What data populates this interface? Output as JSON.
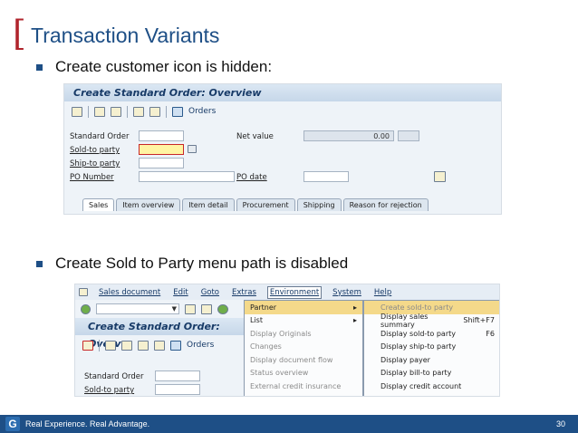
{
  "slide": {
    "title": "Transaction Variants",
    "bullet1": "Create customer icon is hidden:",
    "bullet2": "Create Sold to Party menu path is disabled"
  },
  "sap1": {
    "title": "Create Standard Order: Overview",
    "toolbar_orders": "Orders",
    "labels": {
      "standard_order": "Standard Order",
      "sold_to": "Sold-to party",
      "ship_to": "Ship-to party",
      "po_number": "PO Number",
      "net_value": "Net value",
      "po_date": "PO date"
    },
    "net_value_amount": "0.00",
    "tabs": [
      "Sales",
      "Item overview",
      "Item detail",
      "Procurement",
      "Shipping",
      "Reason for rejection"
    ]
  },
  "sap2": {
    "menubar": [
      "Sales document",
      "Edit",
      "Goto",
      "Extras",
      "Environment",
      "System",
      "Help"
    ],
    "title": "Create Standard Order: Overv",
    "toolbar_orders": "Orders",
    "labels": {
      "standard_order": "Standard Order",
      "sold_to": "Sold-to party"
    },
    "environment_menu": [
      "Partner",
      "List",
      "Display Originals",
      "Changes",
      "Display document flow",
      "Status overview",
      "External credit insurance"
    ],
    "partner_submenu": [
      {
        "label": "Create sold-to party",
        "shortcut": ""
      },
      {
        "label": "Display sales summary",
        "shortcut": "Shift+F7"
      },
      {
        "label": "Display sold-to party",
        "shortcut": "F6"
      },
      {
        "label": "Display ship-to party",
        "shortcut": ""
      },
      {
        "label": "Display payer",
        "shortcut": ""
      },
      {
        "label": "Display bill-to party",
        "shortcut": ""
      },
      {
        "label": "Display credit account",
        "shortcut": ""
      }
    ]
  },
  "footer": {
    "logo_letter": "G",
    "tagline": "Real Experience. Real Advantage.",
    "page": "30"
  },
  "colors": {
    "title_blue": "#1e4f86",
    "bracket_red": "#b0242c",
    "highlight": "#f4d98a",
    "footer_bg": "#1e4f86"
  }
}
